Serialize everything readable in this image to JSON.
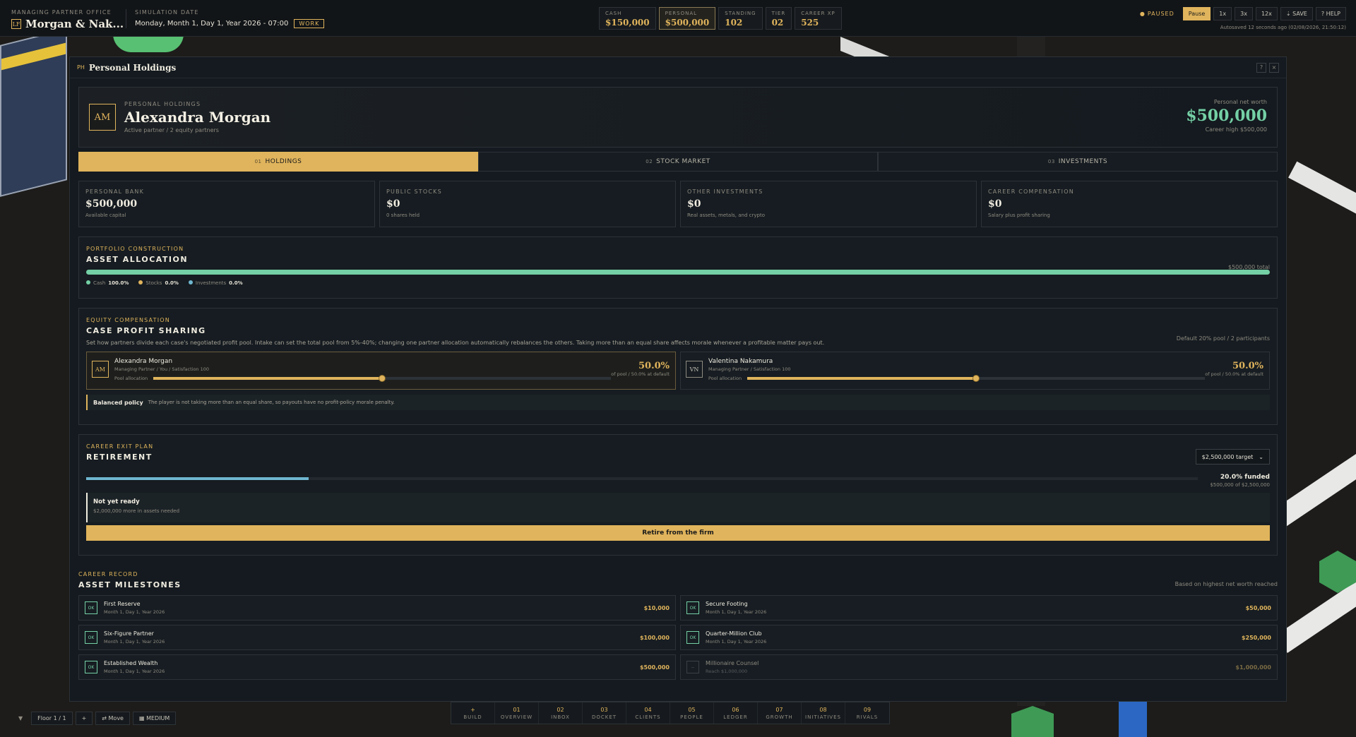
{
  "topbar": {
    "office_label": "MANAGING PARTNER OFFICE",
    "firm_badge": "LF",
    "firm_name": "Morgan & Nak...",
    "date_label": "SIMULATION DATE",
    "date_value": "Monday, Month 1, Day 1, Year 2026 - 07:00",
    "mode": "WORK",
    "stats": [
      {
        "label": "CASH",
        "value": "$150,000"
      },
      {
        "label": "PERSONAL",
        "value": "$500,000"
      },
      {
        "label": "STANDING",
        "value": "102"
      },
      {
        "label": "TIER",
        "value": "02"
      },
      {
        "label": "CAREER XP",
        "value": "525"
      }
    ],
    "paused": "PAUSED",
    "speed": [
      "Pause",
      "1x",
      "3x",
      "12x"
    ],
    "save": "SAVE",
    "help": "HELP",
    "autosave": "Autosaved 12 seconds ago (02/08/2026, 21:50:12)"
  },
  "modal": {
    "tag": "PH",
    "title": "Personal Holdings",
    "help_btn": "?",
    "close_btn": "×",
    "hero": {
      "eyebrow": "PERSONAL HOLDINGS",
      "initials": "AM",
      "name": "Alexandra Morgan",
      "subtitle": "Active partner / 2 equity partners",
      "networth_label": "Personal net worth",
      "networth": "$500,000",
      "career_high": "Career high $500,000"
    },
    "tabs": [
      {
        "num": "01",
        "label": "HOLDINGS"
      },
      {
        "num": "02",
        "label": "STOCK MARKET"
      },
      {
        "num": "03",
        "label": "INVESTMENTS"
      }
    ],
    "cards": [
      {
        "label": "PERSONAL BANK",
        "value": "$500,000",
        "sub": "Available capital"
      },
      {
        "label": "PUBLIC STOCKS",
        "value": "$0",
        "sub": "0 shares held"
      },
      {
        "label": "OTHER INVESTMENTS",
        "value": "$0",
        "sub": "Real assets, metals, and crypto"
      },
      {
        "label": "CAREER COMPENSATION",
        "value": "$0",
        "sub": "Salary plus profit sharing"
      }
    ],
    "allocation": {
      "eyebrow": "PORTFOLIO CONSTRUCTION",
      "title": "ASSET ALLOCATION",
      "total": "$500,000 total",
      "legend": [
        {
          "name": "Cash",
          "pct": "100.0%",
          "color": "#74d0a6"
        },
        {
          "name": "Stocks",
          "pct": "0.0%",
          "color": "#e0b45c"
        },
        {
          "name": "Investments",
          "pct": "0.0%",
          "color": "#6fb6d0"
        }
      ]
    },
    "profit": {
      "eyebrow": "EQUITY COMPENSATION",
      "title": "CASE PROFIT SHARING",
      "pool": "Default 20% pool / 2 participants",
      "desc": "Set how partners divide each case's negotiated profit pool. Intake can set the total pool from 5%-40%; changing one partner allocation automatically rebalances the others. Taking more than an equal share affects morale whenever a profitable matter pays out.",
      "slider_label": "Pool allocation",
      "partners": [
        {
          "initials": "AM",
          "name": "Alexandra Morgan",
          "role": "Managing Partner / You / Satisfaction 100",
          "pct": "50.0%",
          "sub": "of pool / 50.0% at default",
          "share": 0.5
        },
        {
          "initials": "VN",
          "name": "Valentina Nakamura",
          "role": "Managing Partner / Satisfaction 100",
          "pct": "50.0%",
          "sub": "of pool / 50.0% at default",
          "share": 0.5
        }
      ],
      "policy_title": "Balanced policy",
      "policy_text": "The player is not taking more than an equal share, so payouts have no profit-policy morale penalty."
    },
    "retirement": {
      "eyebrow": "CAREER EXIT PLAN",
      "title": "RETIREMENT",
      "target": "$2,500,000 target",
      "funded_fraction": 0.2,
      "funded": "20.0% funded",
      "funded_sub": "$500,000 of $2,500,000",
      "status": "Not yet ready",
      "status_sub": "$2,000,000 more in assets needed",
      "button": "Retire from the firm"
    },
    "milestones": {
      "eyebrow": "CAREER RECORD",
      "title": "ASSET MILESTONES",
      "note": "Based on highest net worth reached",
      "items": [
        {
          "badge": "OK",
          "name": "First Reserve",
          "date": "Month 1, Day 1, Year 2026",
          "amount": "$10,000"
        },
        {
          "badge": "OK",
          "name": "Secure Footing",
          "date": "Month 1, Day 1, Year 2026",
          "amount": "$50,000"
        },
        {
          "badge": "OK",
          "name": "Six-Figure Partner",
          "date": "Month 1, Day 1, Year 2026",
          "amount": "$100,000"
        },
        {
          "badge": "OK",
          "name": "Quarter-Million Club",
          "date": "Month 1, Day 1, Year 2026",
          "amount": "$250,000"
        },
        {
          "badge": "OK",
          "name": "Established Wealth",
          "date": "Month 1, Day 1, Year 2026",
          "amount": "$500,000"
        },
        {
          "badge": "--",
          "name": "Millionaire Counsel",
          "date": "Reach $1,000,000",
          "amount": "$1,000,000"
        }
      ]
    }
  },
  "bottom": {
    "floor": "Floor 1 / 1",
    "plus": "+",
    "move": "Move",
    "size": "MEDIUM",
    "nav": [
      {
        "num": "+",
        "label": "BUILD"
      },
      {
        "num": "01",
        "label": "OVERVIEW"
      },
      {
        "num": "02",
        "label": "INBOX"
      },
      {
        "num": "03",
        "label": "DOCKET"
      },
      {
        "num": "04",
        "label": "CLIENTS"
      },
      {
        "num": "05",
        "label": "PEOPLE"
      },
      {
        "num": "06",
        "label": "LEDGER"
      },
      {
        "num": "07",
        "label": "GROWTH"
      },
      {
        "num": "08",
        "label": "INITIATIVES"
      },
      {
        "num": "09",
        "label": "RIVALS"
      }
    ]
  }
}
